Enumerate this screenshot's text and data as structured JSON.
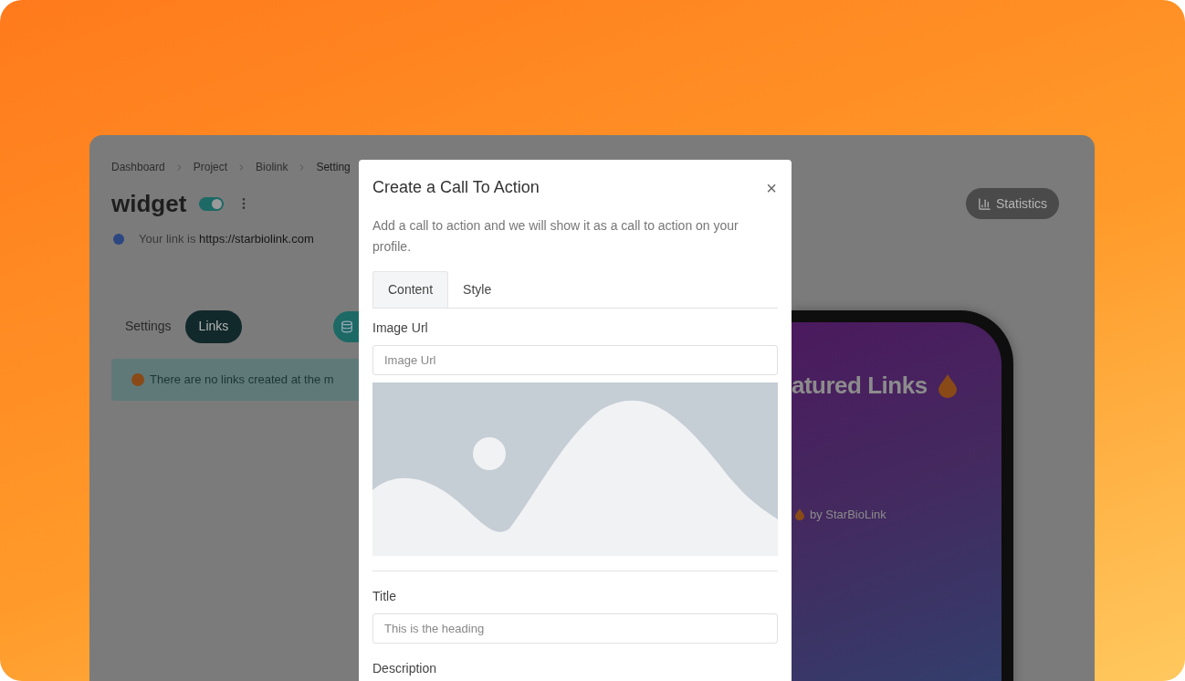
{
  "breadcrumbs": [
    "Dashboard",
    "Project",
    "Biolink",
    "Setting"
  ],
  "page": {
    "title": "widget",
    "enabled": true,
    "link_prefix": "Your link is",
    "link_url": "https://starbiolink.com"
  },
  "statistics_button": "Statistics",
  "tabs": [
    {
      "label": "Settings",
      "selected": false
    },
    {
      "label": "Links",
      "selected": true
    }
  ],
  "alert": "There are no links created at the m",
  "preview": {
    "heading": "atured Links",
    "footer": "by StarBioLink"
  },
  "modal": {
    "title": "Create a Call To Action",
    "close": "×",
    "description": "Add a call to action and we will show it as a call to action on your profile.",
    "tabs": [
      {
        "label": "Content",
        "selected": true
      },
      {
        "label": "Style",
        "selected": false
      }
    ],
    "image_url": {
      "label": "Image Url",
      "placeholder": "Image Url"
    },
    "title_field": {
      "label": "Title",
      "placeholder": "This is the heading"
    },
    "description_label": "Description"
  }
}
